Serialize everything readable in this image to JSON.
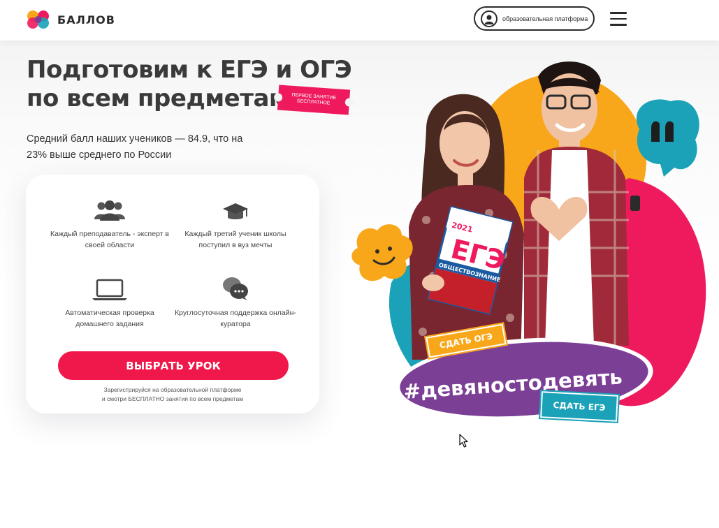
{
  "header": {
    "logo_text": "БАЛЛОВ",
    "platform_button": "образовательная платформа",
    "menu_icon": "hamburger-menu-icon"
  },
  "hero": {
    "title_line1": "Подготовим к ЕГЭ и ОГЭ",
    "title_line2": "по всем предметам",
    "badge": "Первое занятие бесплатное",
    "subtitle": "Средний балл наших учеников — 84.9, что на 23% выше среднего по России"
  },
  "features": {
    "items": [
      {
        "icon": "people-icon",
        "text": "Каждый преподаватель - эксперт в своей области"
      },
      {
        "icon": "graduation-cap-icon",
        "text": "Каждый третий ученик школы поступил в вуз мечты"
      },
      {
        "icon": "laptop-icon",
        "text": "Автоматическая проверка домашнего задания"
      },
      {
        "icon": "chat-bubbles-icon",
        "text": "Круглосуточная поддержка онлайн-куратора"
      }
    ],
    "cta_label": "ВЫБРАТЬ УРОК",
    "note_line1": "Зарегистрируйся на образовательной платформе",
    "note_line2": "и смотри БЕСПЛАТНО занятия по всем предметам"
  },
  "illustration": {
    "book_label": "ЕГЭ",
    "book_year": "2021",
    "book_subject": "ОБЩЕСТВОЗНАНИЕ",
    "hashtag": "#девяностодевять",
    "sticker_oge": "СДАТЬ ОГЭ",
    "sticker_ege": "СДАТЬ ЕГЭ"
  },
  "colors": {
    "accent_red": "#f0184a",
    "pink": "#ef1a5e",
    "orange": "#f8a71b",
    "teal": "#1ba2b8",
    "purple": "#7b3f96",
    "text": "#3a3a3a"
  }
}
